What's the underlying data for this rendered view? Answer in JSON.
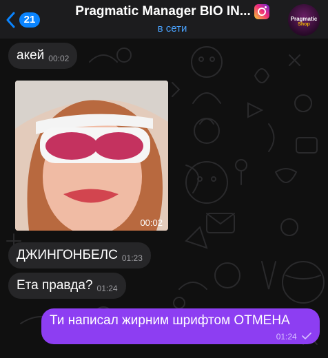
{
  "header": {
    "back_count": "21",
    "title": "Pragmatic Manager BIO IN...",
    "status": "в сети",
    "avatar_line1": "Pragmatic",
    "avatar_line2": "Shop"
  },
  "messages": [
    {
      "text": "акей",
      "time": "00:02",
      "direction": "in"
    },
    {
      "type": "video",
      "duration": "00:02",
      "direction": "in"
    },
    {
      "text": "ДЖИНГОНБЕЛС",
      "time": "01:23",
      "direction": "in"
    },
    {
      "text": "Ета правда?",
      "time": "01:24",
      "direction": "in"
    },
    {
      "text": "Ти написал жирним шрифтом ОТМЕНА",
      "time": "01:24",
      "direction": "out",
      "read": true
    }
  ],
  "colors": {
    "outgoing_bubble": "#8d3ef2",
    "incoming_bubble": "#262628",
    "accent": "#0a84ff",
    "status": "#4aa3ff"
  }
}
